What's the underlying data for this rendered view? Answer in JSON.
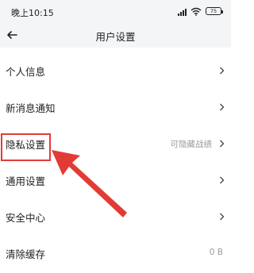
{
  "status_bar": {
    "time": "晚上10:15",
    "battery": "75"
  },
  "header": {
    "title": "用户设置",
    "back_icon": "arrow-left-icon"
  },
  "settings": [
    {
      "label": "个人信息",
      "value": "",
      "chevron": true
    },
    {
      "label": "新消息通知",
      "value": "",
      "chevron": true
    },
    {
      "label": "隐私设置",
      "value": "可隐藏战绩",
      "chevron": true
    },
    {
      "label": "通用设置",
      "value": "",
      "chevron": true
    },
    {
      "label": "安全中心",
      "value": "",
      "chevron": true
    },
    {
      "label": "清除缓存",
      "value": "0 B",
      "chevron": false
    }
  ],
  "annotation": {
    "color": "#e23b35",
    "target": "隐私设置"
  }
}
